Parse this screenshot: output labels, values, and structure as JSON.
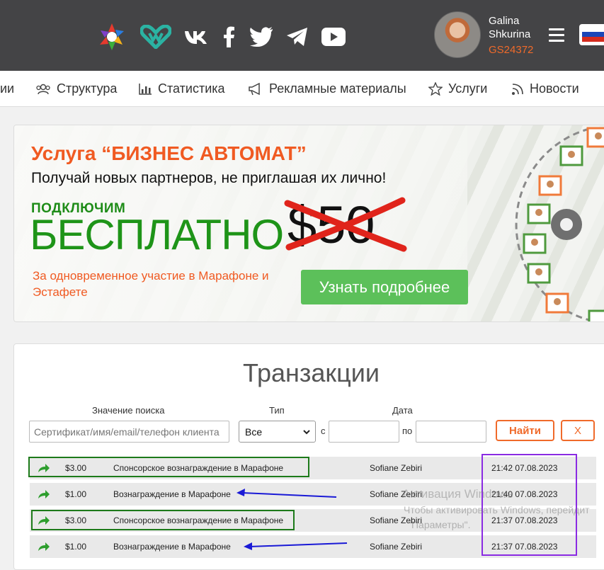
{
  "header": {
    "social_icons": [
      "logo-icon",
      "heart-logo-icon",
      "vk-icon",
      "facebook-icon",
      "twitter-icon",
      "telegram-icon",
      "youtube-icon"
    ],
    "user_first": "Galina",
    "user_last": "Shkurina",
    "user_code": "GS24372"
  },
  "nav": {
    "items": [
      {
        "label": "ии",
        "icon": ""
      },
      {
        "label": "Структура",
        "icon": "users-icon"
      },
      {
        "label": "Статистика",
        "icon": "chart-icon"
      },
      {
        "label": "Рекламные материалы",
        "icon": "megaphone-icon"
      },
      {
        "label": "Услуги",
        "icon": "star-icon"
      },
      {
        "label": "Новости",
        "icon": "rss-icon"
      }
    ]
  },
  "banner": {
    "title": "Услуга “БИЗНЕС АВТОМАТ”",
    "subtitle": "Получай новых партнеров, не приглашая их лично!",
    "small": "ПОДКЛЮЧИМ",
    "big": "БЕСПЛАТНО",
    "price": "$50",
    "note": "За одновременное участие в Марафоне и Эстафете",
    "button": "Узнать подробнее"
  },
  "transactions": {
    "title": "Транзакции",
    "search_label": "Значение поиска",
    "search_placeholder": "Сертификат/имя/email/телефон клиента",
    "type_label": "Тип",
    "type_value": "Все",
    "date_label": "Дата",
    "from": "с",
    "to": "по",
    "find_button": "Найти",
    "clear_button": "X",
    "rows": [
      {
        "amount": "$3.00",
        "desc": "Спонсорское вознаграждение в Марафоне",
        "name": "Sofiane Zebiri",
        "time": "21:42 07.08.2023"
      },
      {
        "amount": "$1.00",
        "desc": "Вознаграждение в Марафоне",
        "name": "Sofiane Zebiri",
        "time": "21:40 07.08.2023"
      },
      {
        "amount": "$3.00",
        "desc": "Спонсорское вознаграждение в Марафоне",
        "name": "Sofiane Zebiri",
        "time": "21:37 07.08.2023"
      },
      {
        "amount": "$1.00",
        "desc": "Вознаграждение в Марафоне",
        "name": "Sofiane Zebiri",
        "time": "21:37 07.08.2023"
      }
    ]
  },
  "watermark": {
    "line1": "Активация Windows",
    "line2": "Чтобы активировать Windows, перейдит",
    "line3": "\"Параметры\"."
  },
  "colors": {
    "accent": "#f06a2a",
    "green": "#1e9418",
    "header_bg": "#444446"
  }
}
